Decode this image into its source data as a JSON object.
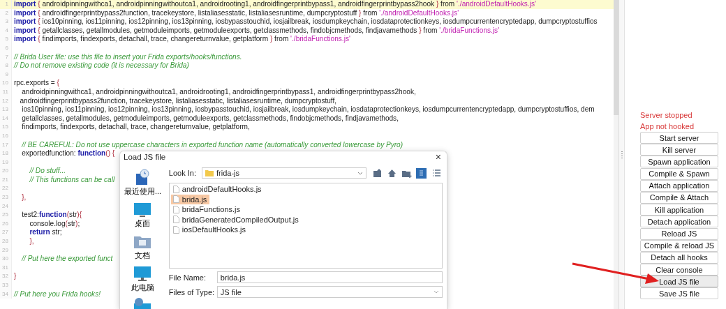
{
  "editor": {
    "lines": [
      {
        "number": "1",
        "highlighted": true,
        "segments": [
          {
            "kind": "keyword",
            "text": "import"
          },
          {
            "kind": "brace",
            "text": " { "
          },
          {
            "kind": "plain",
            "text": "androidpinningwithca1, androidpinningwithoutca1, androidrooting1, androidfingerprintbypass1, androidfingerprintbypass2hook"
          },
          {
            "kind": "brace",
            "text": " } "
          },
          {
            "kind": "plain",
            "text": "from "
          },
          {
            "kind": "string",
            "text": "'./androidDefaultHooks.js'"
          }
        ]
      },
      {
        "number": "2",
        "highlighted": false,
        "segments": [
          {
            "kind": "keyword",
            "text": "import"
          },
          {
            "kind": "brace",
            "text": " { "
          },
          {
            "kind": "plain",
            "text": "androidfingerprintbypass2function, tracekeystore, listaliasesstatic, listaliasesruntime, dumpcryptostuff"
          },
          {
            "kind": "brace",
            "text": " } "
          },
          {
            "kind": "plain",
            "text": "from "
          },
          {
            "kind": "string",
            "text": "'./androidDefaultHooks.js'"
          }
        ]
      },
      {
        "number": "3",
        "highlighted": false,
        "segments": [
          {
            "kind": "keyword",
            "text": "import"
          },
          {
            "kind": "brace",
            "text": " { "
          },
          {
            "kind": "plain",
            "text": "ios10pinning, ios11pinning, ios12pinning, ios13pinning, iosbypasstouchid, iosjailbreak, iosdumpkeychain, iosdataprotectionkeys, iosdumpcurrentencryptedapp, dumpcryptostuffios"
          }
        ]
      },
      {
        "number": "4",
        "highlighted": false,
        "segments": [
          {
            "kind": "keyword",
            "text": "import"
          },
          {
            "kind": "brace",
            "text": " { "
          },
          {
            "kind": "plain",
            "text": "getallclasses, getallmodules, getmoduleimports, getmoduleexports, getclassmethods, findobjcmethods, findjavamethods"
          },
          {
            "kind": "brace",
            "text": " } "
          },
          {
            "kind": "plain",
            "text": "from "
          },
          {
            "kind": "string",
            "text": "'./bridaFunctions.js'"
          }
        ]
      },
      {
        "number": "5",
        "highlighted": false,
        "segments": [
          {
            "kind": "keyword",
            "text": "import"
          },
          {
            "kind": "brace",
            "text": " { "
          },
          {
            "kind": "plain",
            "text": "findimports, findexports, detachall, trace, changereturnvalue, getplatform"
          },
          {
            "kind": "brace",
            "text": " } "
          },
          {
            "kind": "plain",
            "text": "from "
          },
          {
            "kind": "string",
            "text": "'./bridaFunctions.js'"
          }
        ]
      },
      {
        "number": "6",
        "highlighted": false
      },
      {
        "number": "7",
        "highlighted": false,
        "segments": [
          {
            "kind": "comment",
            "text": "// Brida User file: use this file to insert your Frida exports/hooks/functions."
          }
        ]
      },
      {
        "number": "8",
        "highlighted": false,
        "segments": [
          {
            "kind": "comment",
            "text": "// Do not remove existing code (it is necessary for Brida)"
          }
        ]
      },
      {
        "number": "9",
        "highlighted": false
      },
      {
        "number": "10",
        "highlighted": false,
        "segments": [
          {
            "kind": "plain",
            "text": "rpc.exports = "
          },
          {
            "kind": "brace",
            "text": "{"
          }
        ]
      },
      {
        "number": "11",
        "highlighted": false,
        "segments": [
          {
            "kind": "plain",
            "text": "    androidpinningwithca1, androidpinningwithoutca1, androidrooting1, androidfingerprintbypass1, androidfingerprintbypass2hook,"
          }
        ]
      },
      {
        "number": "12",
        "highlighted": false,
        "segments": [
          {
            "kind": "plain",
            "text": "   androidfingerprintbypass2function, tracekeystore, listaliasesstatic, listaliasesruntime, dumpcryptostuff,"
          }
        ]
      },
      {
        "number": "13",
        "highlighted": false,
        "segments": [
          {
            "kind": "plain",
            "text": "    ios10pinning, ios11pinning, ios12pinning, ios13pinning, iosbypasstouchid, iosjailbreak, iosdumpkeychain, iosdataprotectionkeys, iosdumpcurrentencryptedapp, dumpcryptostuffios, dem"
          }
        ]
      },
      {
        "number": "14",
        "highlighted": false,
        "segments": [
          {
            "kind": "plain",
            "text": "    getallclasses, getallmodules, getmoduleimports, getmoduleexports, getclassmethods, findobjcmethods, findjavamethods,"
          }
        ]
      },
      {
        "number": "15",
        "highlighted": false,
        "segments": [
          {
            "kind": "plain",
            "text": "    findimports, findexports, detachall, trace, changereturnvalue, getplatform,"
          }
        ]
      },
      {
        "number": "16",
        "highlighted": false
      },
      {
        "number": "17",
        "highlighted": false,
        "segments": [
          {
            "kind": "comment",
            "text": "    // BE CAREFUL: Do not use uppercase characters in exported function name (automatically converted lowercase by Pyro)"
          }
        ]
      },
      {
        "number": "18",
        "highlighted": false,
        "segments": [
          {
            "kind": "plain",
            "text": "    exportedfunction: "
          },
          {
            "kind": "keyword",
            "text": "function"
          },
          {
            "kind": "brace",
            "text": "() {"
          }
        ]
      },
      {
        "number": "19",
        "highlighted": false
      },
      {
        "number": "20",
        "highlighted": false,
        "segments": [
          {
            "kind": "comment",
            "text": "        // Do stuff..."
          }
        ]
      },
      {
        "number": "21",
        "highlighted": false,
        "segments": [
          {
            "kind": "comment",
            "text": "        // This functions can be call"
          }
        ]
      },
      {
        "number": "22",
        "highlighted": false
      },
      {
        "number": "23",
        "highlighted": false,
        "segments": [
          {
            "kind": "brace",
            "text": "    },"
          }
        ]
      },
      {
        "number": "24",
        "highlighted": false
      },
      {
        "number": "25",
        "highlighted": false,
        "segments": [
          {
            "kind": "plain",
            "text": "    test2:"
          },
          {
            "kind": "keyword",
            "text": "function"
          },
          {
            "kind": "brace",
            "text": "("
          },
          {
            "kind": "plain",
            "text": "str"
          },
          {
            "kind": "brace",
            "text": "){"
          }
        ]
      },
      {
        "number": "26",
        "highlighted": false,
        "segments": [
          {
            "kind": "plain",
            "text": "        console.log"
          },
          {
            "kind": "brace",
            "text": "("
          },
          {
            "kind": "plain",
            "text": "str"
          },
          {
            "kind": "brace",
            "text": ")"
          },
          {
            "kind": "plain",
            "text": ";"
          }
        ]
      },
      {
        "number": "27",
        "highlighted": false,
        "segments": [
          {
            "kind": "keyword",
            "text": "        return"
          },
          {
            "kind": "plain",
            "text": " str;"
          }
        ]
      },
      {
        "number": "28",
        "highlighted": false,
        "segments": [
          {
            "kind": "brace",
            "text": "        },"
          }
        ]
      },
      {
        "number": "29",
        "highlighted": false
      },
      {
        "number": "30",
        "highlighted": false,
        "segments": [
          {
            "kind": "comment",
            "text": "    // Put here the exported funct"
          }
        ]
      },
      {
        "number": "31",
        "highlighted": false
      },
      {
        "number": "32",
        "highlighted": false,
        "segments": [
          {
            "kind": "brace",
            "text": "}"
          }
        ]
      },
      {
        "number": "33",
        "highlighted": false
      },
      {
        "number": "34",
        "highlighted": false,
        "segments": [
          {
            "kind": "comment",
            "text": "// Put here you Frida hooks!"
          }
        ]
      }
    ]
  },
  "status": [
    "Server stopped",
    "App not hooked"
  ],
  "buttons": [
    {
      "label": "Start server",
      "highlighted": false
    },
    {
      "label": "Kill server",
      "highlighted": false
    },
    {
      "label": "Spawn application",
      "highlighted": false
    },
    {
      "label": "Compile & Spawn",
      "highlighted": false
    },
    {
      "label": "Attach application",
      "highlighted": false
    },
    {
      "label": "Compile & Attach",
      "highlighted": false
    },
    {
      "label": "Kill application",
      "highlighted": false
    },
    {
      "label": "Detach application",
      "highlighted": false
    },
    {
      "label": "Reload JS",
      "highlighted": false
    },
    {
      "label": "Compile & reload JS",
      "highlighted": false
    },
    {
      "label": "Detach all hooks",
      "highlighted": false
    },
    {
      "label": "Clear console",
      "highlighted": false
    },
    {
      "label": "Load JS file",
      "highlighted": true
    },
    {
      "label": "Save JS file",
      "highlighted": false
    }
  ],
  "dialog": {
    "title": "Load JS file",
    "close": "×",
    "places": [
      {
        "kind": "recent",
        "label": "最近使用..."
      },
      {
        "kind": "desktop",
        "label": "桌面"
      },
      {
        "kind": "documents",
        "label": "文档"
      },
      {
        "kind": "computer",
        "label": "此电脑"
      },
      {
        "kind": "network"
      }
    ],
    "look_in": {
      "label": "Look In:",
      "value": "frida-js"
    },
    "toolbar": [
      {
        "kind": "up",
        "selected": false
      },
      {
        "kind": "home",
        "selected": false
      },
      {
        "kind": "new-folder",
        "selected": false
      },
      {
        "kind": "list",
        "selected": true
      },
      {
        "kind": "details",
        "selected": false
      }
    ],
    "files": [
      {
        "name": "androidDefaultHooks.js",
        "selected": false
      },
      {
        "name": "brida.js",
        "selected": true
      },
      {
        "name": "bridaFunctions.js",
        "selected": false
      },
      {
        "name": "bridaGeneratedCompiledOutput.js",
        "selected": false
      },
      {
        "name": "iosDefaultHooks.js",
        "selected": false
      }
    ],
    "file_name": {
      "label": "File Name:",
      "value": "brida.js"
    },
    "file_type": {
      "label": "Files of Type:",
      "value": "JS file"
    }
  }
}
